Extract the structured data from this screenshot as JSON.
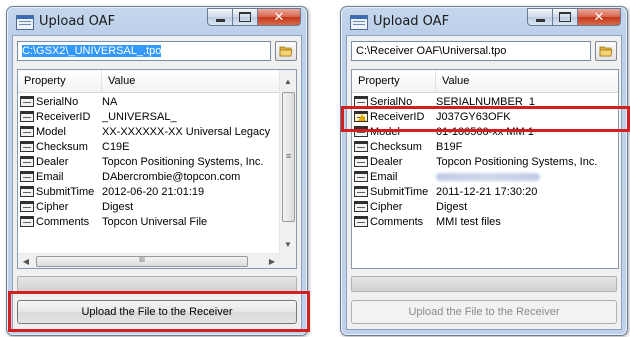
{
  "window_left": {
    "title": "Upload OAF",
    "path_value": "C:\\GSX2\\_UNIVERSAL_.tpo",
    "columns": {
      "property": "Property",
      "value": "Value"
    },
    "rows": [
      {
        "property": "SerialNo",
        "value": "NA"
      },
      {
        "property": "ReceiverID",
        "value": "_UNIVERSAL_"
      },
      {
        "property": "Model",
        "value": "XX-XXXXXX-XX Universal Legacy"
      },
      {
        "property": "Checksum",
        "value": "C19E"
      },
      {
        "property": "Dealer",
        "value": "Topcon Positioning Systems, Inc."
      },
      {
        "property": "Email",
        "value": "DAbercrombie@topcon.com"
      },
      {
        "property": "SubmitTime",
        "value": "2012-06-20 21:01:19"
      },
      {
        "property": "Cipher",
        "value": "Digest"
      },
      {
        "property": "Comments",
        "value": "Topcon Universal File"
      }
    ],
    "scroll_thumb_glyph": "≡",
    "hscroll_thumb_glyph": "III",
    "upload_button_label": "Upload the File to the Receiver",
    "upload_button_enabled": true
  },
  "window_right": {
    "title": "Upload OAF",
    "path_value": "C:\\Receiver OAF\\Universal.tpo",
    "columns": {
      "property": "Property",
      "value": "Value"
    },
    "rows": [
      {
        "property": "SerialNo",
        "value": "SERIALNUMBER_1"
      },
      {
        "property": "ReceiverID",
        "value": "J037GY63OFK",
        "warning": true
      },
      {
        "property": "Model",
        "value": "01-100500-xx MM 1"
      },
      {
        "property": "Checksum",
        "value": "B19F"
      },
      {
        "property": "Dealer",
        "value": "Topcon Positioning Systems, Inc."
      },
      {
        "property": "Email",
        "value": "",
        "redacted": true
      },
      {
        "property": "SubmitTime",
        "value": "2011-12-21 17:30:20"
      },
      {
        "property": "Cipher",
        "value": "Digest"
      },
      {
        "property": "Comments",
        "value": "MMI test files"
      }
    ],
    "upload_button_label": "Upload the File to the Receiver",
    "upload_button_enabled": false
  },
  "colors": {
    "highlight": "#d21f1f",
    "selection": "#3399ff",
    "title_bar": "#bcd0e9",
    "close_button": "#c2381a"
  }
}
